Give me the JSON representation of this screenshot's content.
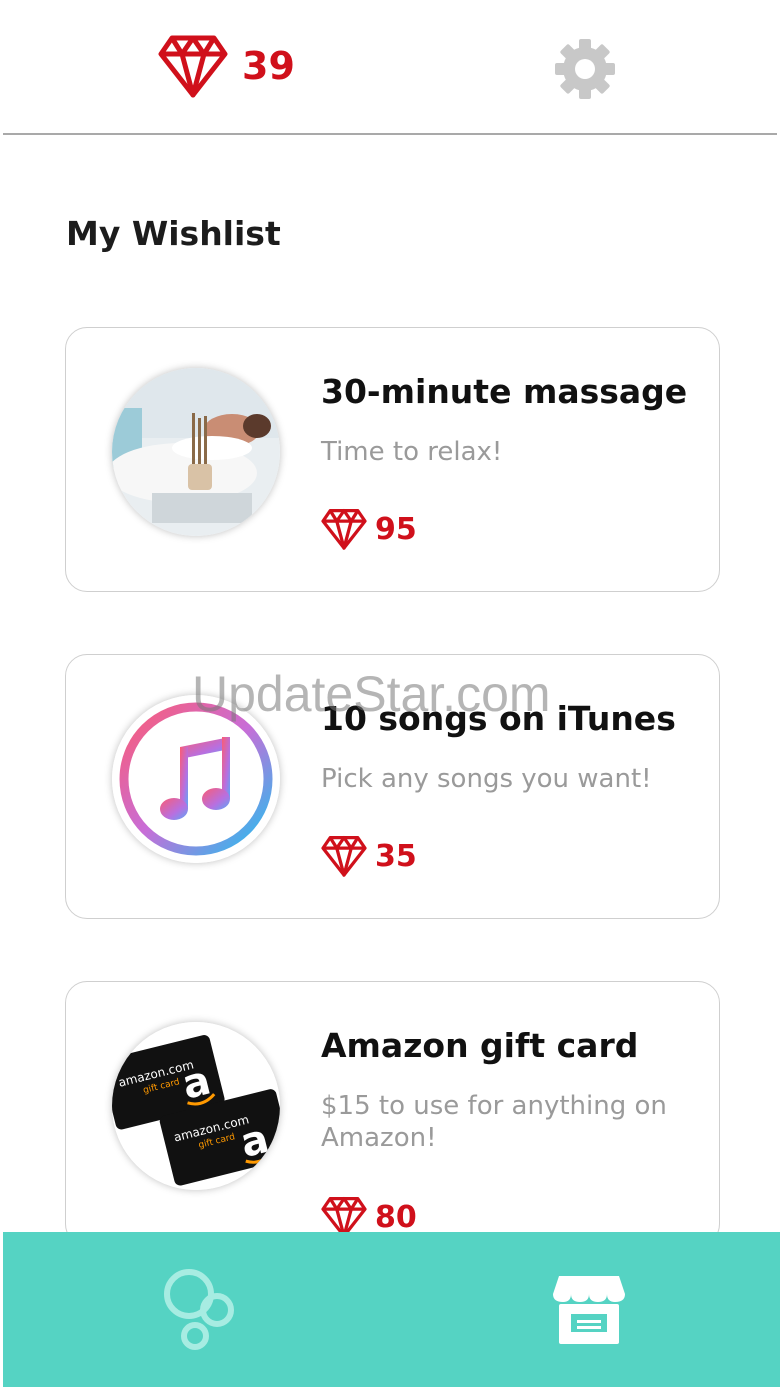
{
  "header": {
    "gem_count": "39",
    "gem_icon": "gem-icon",
    "settings_icon": "gear-icon"
  },
  "page_title": "My Wishlist",
  "items": [
    {
      "title": "30-minute massage",
      "description": "Time to relax!",
      "price": "95",
      "image": "massage-photo"
    },
    {
      "title": "10 songs on iTunes",
      "description": "Pick any songs you want!",
      "price": "35",
      "image": "itunes-logo"
    },
    {
      "title": "Amazon gift card",
      "description": "$15 to use for anything on Amazon!",
      "price": "80",
      "image": "amazon-gift-cards"
    }
  ],
  "watermark": "UpdateStar.com",
  "bottom_nav": {
    "left_icon": "bubbles-icon",
    "right_icon": "store-icon"
  },
  "colors": {
    "accent": "#d0101b",
    "nav_background": "#55d3c3",
    "gear": "#c8c8c8"
  }
}
